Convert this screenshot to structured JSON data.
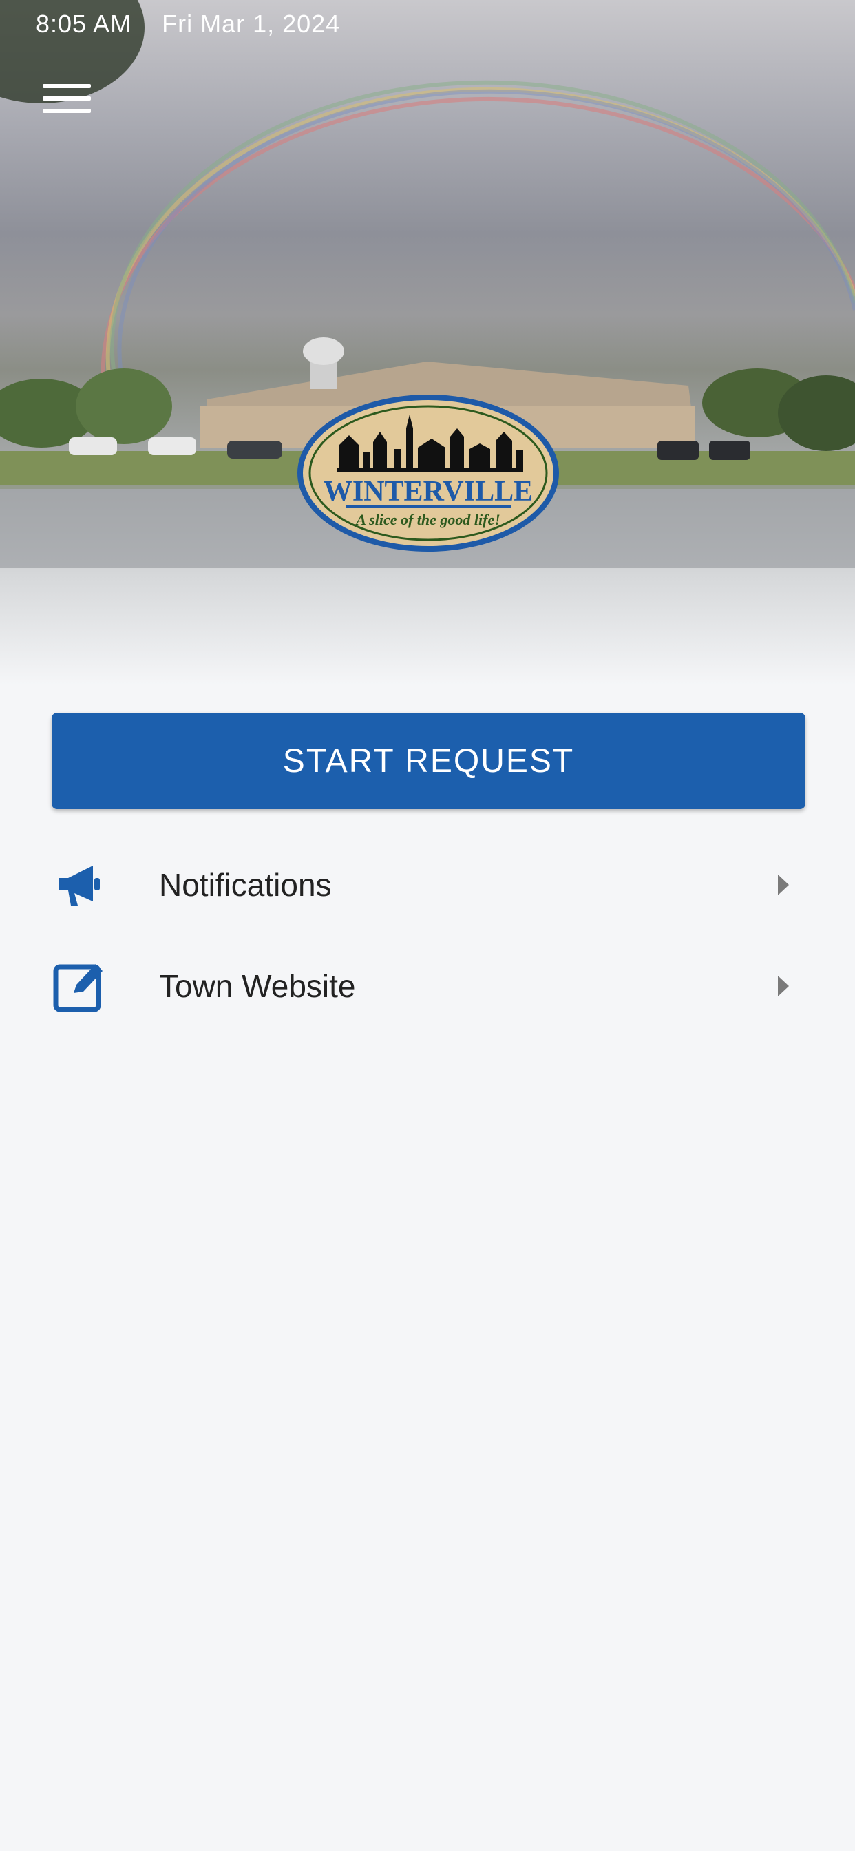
{
  "status_bar": {
    "time": "8:05 AM",
    "date": "Fri Mar 1, 2024"
  },
  "hero": {
    "logo_text": "WINTERVILLE",
    "logo_tagline": "A slice of the good life!"
  },
  "actions": {
    "start_request_label": "START REQUEST"
  },
  "list": [
    {
      "label": "Notifications",
      "icon": "megaphone-icon"
    },
    {
      "label": "Town Website",
      "icon": "edit-square-icon"
    }
  ],
  "colors": {
    "primary": "#1c5fad",
    "background": "#f5f6f8",
    "logo_fill": "#e2c99a",
    "logo_text": "#1e5aa8",
    "logo_tagline": "#2d5a1e"
  }
}
